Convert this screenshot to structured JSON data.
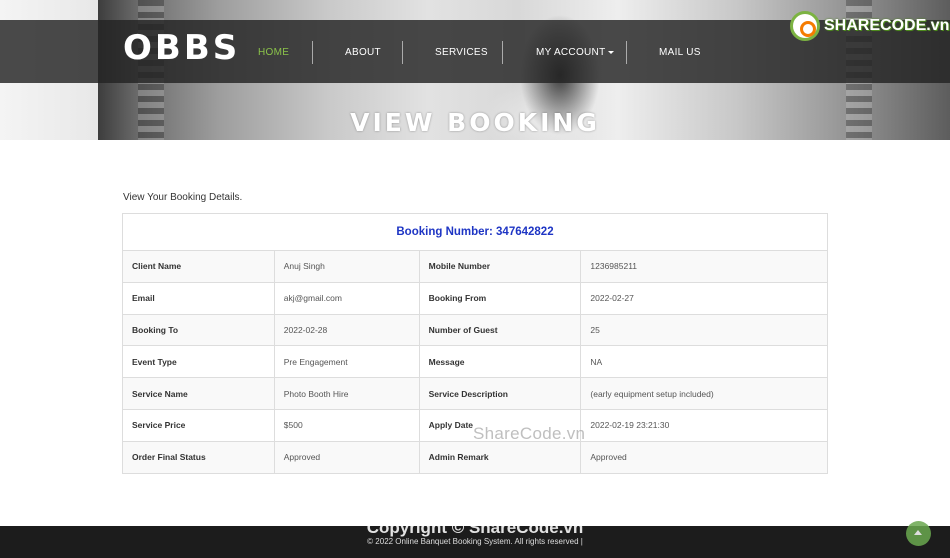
{
  "brand": {
    "name": "OBBS"
  },
  "nav": {
    "items": [
      {
        "label": "HOME"
      },
      {
        "label": "ABOUT"
      },
      {
        "label": "SERVICES"
      },
      {
        "label": "MY ACCOUNT"
      },
      {
        "label": "MAIL US"
      }
    ],
    "active_color": "#8bc34a"
  },
  "hero": {
    "title": "VIEW BOOKING"
  },
  "logo": {
    "text": "SHARECODE.vn"
  },
  "intro": "View Your Booking Details.",
  "booking": {
    "header": "Booking Number: 347642822",
    "rows": [
      {
        "l1": "Client Name",
        "v1": "Anuj Singh",
        "l2": "Mobile Number",
        "v2": "1236985211"
      },
      {
        "l1": "Email",
        "v1": "akj@gmail.com",
        "l2": "Booking From",
        "v2": "2022-02-27"
      },
      {
        "l1": "Booking To",
        "v1": "2022-02-28",
        "l2": "Number of Guest",
        "v2": "25"
      },
      {
        "l1": "Event Type",
        "v1": "Pre Engagement",
        "l2": "Message",
        "v2": "NA"
      },
      {
        "l1": "Service Name",
        "v1": "Photo Booth Hire",
        "l2": "Service Description",
        "v2": "(early equipment setup included)"
      },
      {
        "l1": "Service Price",
        "v1": "$500",
        "l2": "Apply Date",
        "v2": "2022-02-19 23:21:30"
      },
      {
        "l1": "Order Final Status",
        "v1": "Approved",
        "l2": "Admin Remark",
        "v2": "Approved"
      }
    ],
    "header_color": "#1e35c4"
  },
  "footer": {
    "text": "© 2022 Online Banquet Booking System. All rights reserved |"
  },
  "watermarks": {
    "middle": "ShareCode.vn",
    "footer": "Copyright © ShareCode.vn"
  }
}
